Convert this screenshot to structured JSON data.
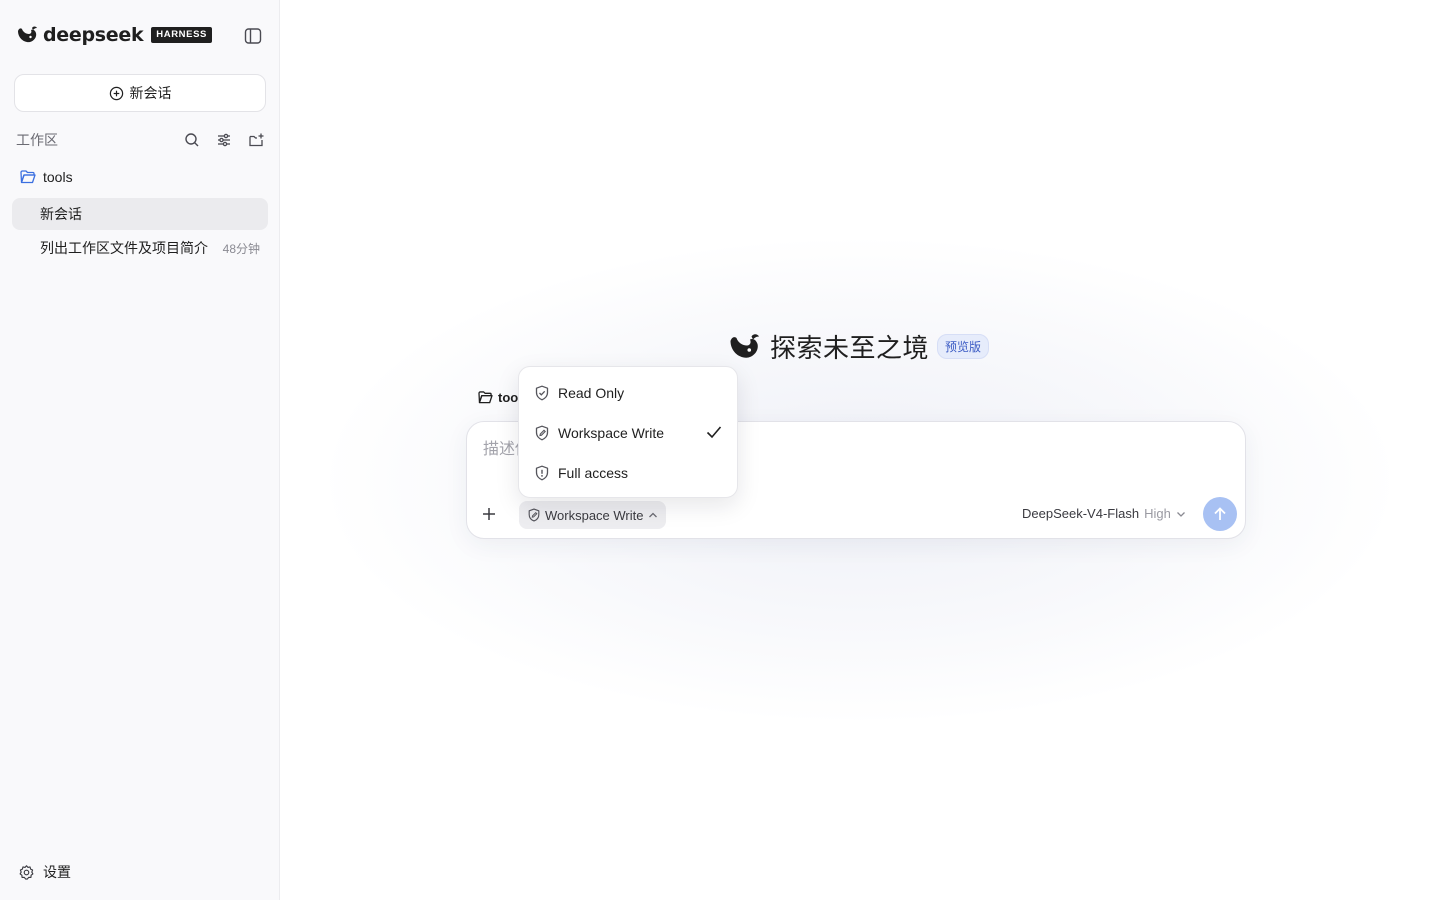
{
  "sidebar": {
    "brand": {
      "name": "deepseek",
      "badge": "HARNESS"
    },
    "new_chat_label": "新会话",
    "workspace": {
      "label": "工作区"
    },
    "folder": {
      "name": "tools"
    },
    "conversations": [
      {
        "title": "新会话",
        "time": "",
        "active": true
      },
      {
        "title": "列出工作区文件及项目简介",
        "time": "48分钟",
        "active": false
      }
    ],
    "settings_label": "设置"
  },
  "main": {
    "hero": {
      "title": "探索未至之境",
      "badge": "预览版"
    },
    "folder_chip": "too",
    "composer": {
      "placeholder": "描述你的任务",
      "mode_label": "Workspace Write",
      "model": "DeepSeek-V4-Flash",
      "effort": "High"
    },
    "permission_menu": {
      "items": [
        {
          "label": "Read Only",
          "icon": "shield-check-icon",
          "selected": false
        },
        {
          "label": "Workspace Write",
          "icon": "shield-edit-icon",
          "selected": true
        },
        {
          "label": "Full access",
          "icon": "shield-alert-icon",
          "selected": false
        }
      ]
    }
  },
  "colors": {
    "accent": "#3b5bc4",
    "send_button": "#a8c1f3",
    "active_item": "#ebebee",
    "sidebar_bg": "#f9f9fb",
    "folder_icon": "#3b6fe0"
  }
}
